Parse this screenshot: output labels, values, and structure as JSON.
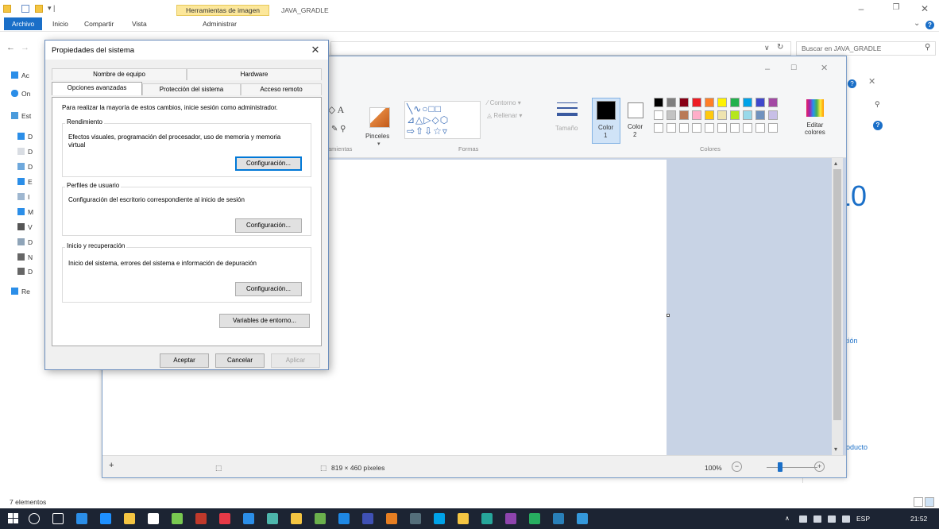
{
  "explorer": {
    "context_tab": "Herramientas de imagen",
    "folder_title": "JAVA_GRADLE",
    "tabs": {
      "archivo": "Archivo",
      "inicio": "Inicio",
      "compartir": "Compartir",
      "vista": "Vista",
      "administrar": "Administrar"
    },
    "search_placeholder": "Buscar en JAVA_GRADLE",
    "nav_items": [
      "Ac",
      "On",
      "Est",
      "D",
      "D",
      "D",
      "E",
      "I",
      "M",
      "V",
      "D",
      "N",
      "D",
      "Re"
    ],
    "status": "7 elementos"
  },
  "paint": {
    "tools_label": "amientas",
    "pinceles": "Pinceles",
    "contorno": "Contorno",
    "rellenar": "Rellenar",
    "formas": "Formas",
    "tamano": "Tamaño",
    "color1": "Color",
    "color1_n": "1",
    "color2": "Color",
    "color2_n": "2",
    "editar": "Editar",
    "colores_btn": "colores",
    "colores_label": "Colores",
    "dimensions": "819 × 460 píxeles",
    "zoom": "100%",
    "palette_row1": [
      "#000000",
      "#7f7f7f",
      "#880015",
      "#ed1c24",
      "#ff7f27",
      "#fff200",
      "#22b14c",
      "#00a2e8",
      "#3f48cc",
      "#a349a4"
    ],
    "palette_row2": [
      "#ffffff",
      "#c3c3c3",
      "#b97a57",
      "#ffaec9",
      "#ffc90e",
      "#efe4b0",
      "#b5e61d",
      "#99d9ea",
      "#7092be",
      "#c8bfe7"
    ]
  },
  "right_panel": {
    "big_text": "10",
    "cion": "ción",
    "producto": "oducto"
  },
  "dialog": {
    "title": "Propiedades del sistema",
    "tabs": {
      "nombre": "Nombre de equipo",
      "hardware": "Hardware",
      "opciones": "Opciones avanzadas",
      "proteccion": "Protección del sistema",
      "remoto": "Acceso remoto"
    },
    "admin_note": "Para realizar la mayoría de estos cambios, inicie sesión como administrador.",
    "rendimiento": {
      "label": "Rendimiento",
      "text": "Efectos visuales, programación del procesador, uso de memoria y memoria virtual",
      "button": "Configuración..."
    },
    "perfiles": {
      "label": "Perfiles de usuario",
      "text": "Configuración del escritorio correspondiente al inicio de sesión",
      "button": "Configuración..."
    },
    "inicio": {
      "label": "Inicio y recuperación",
      "text": "Inicio del sistema, errores del sistema e información de depuración",
      "button": "Configuración..."
    },
    "variables_button": "Variables de entorno...",
    "aceptar": "Aceptar",
    "cancelar": "Cancelar",
    "aplicar": "Aplicar"
  },
  "taskbar": {
    "lang": "ESP",
    "time": "21:52",
    "icon_colors": [
      "#ffffff",
      "#ffffff",
      "#2b8ee8",
      "#1e90ff",
      "#f4c542",
      "#ffffff",
      "#78c850",
      "#c0392b",
      "#e63946",
      "#2b8ee8",
      "#4db6ac",
      "#f4c542",
      "#6ab04c",
      "#1e88e5",
      "#3f51b5",
      "#e67e22",
      "#546e7a",
      "#00a2e8",
      "#f4c542",
      "#26a69a",
      "#8e44ad",
      "#27ae60",
      "#2980b9",
      "#3498db"
    ]
  }
}
